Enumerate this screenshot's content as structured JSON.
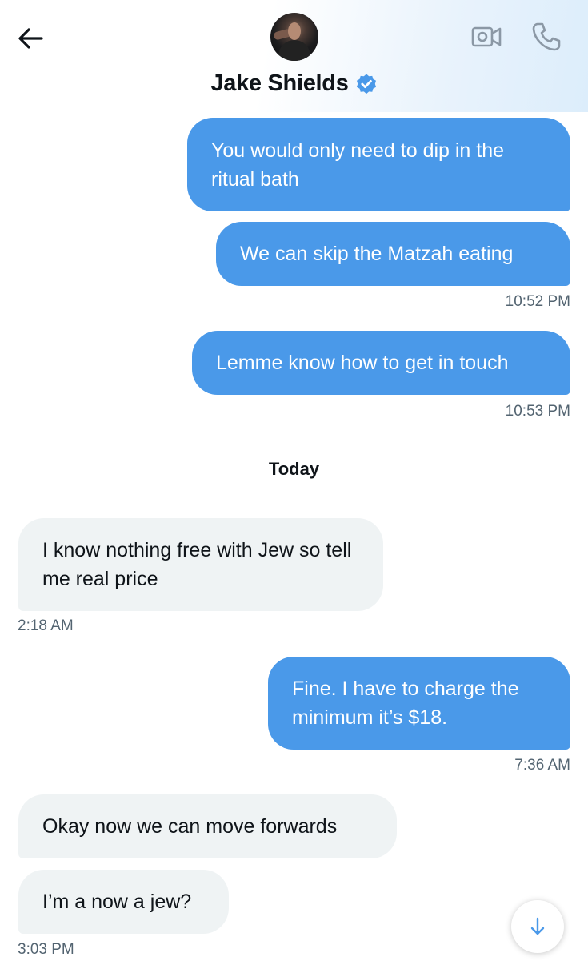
{
  "header": {
    "contact_name": "Jake Shields",
    "verified": true,
    "icons": {
      "back": "arrow-left-icon",
      "video": "video-camera-icon",
      "phone": "phone-icon",
      "verified": "verified-badge-icon"
    },
    "accent_color": "#4a99e9"
  },
  "messages": [
    {
      "direction": "outgoing",
      "text": "You would only need to dip in the ritual bath"
    },
    {
      "direction": "outgoing",
      "text": "We can skip the Matzah eating",
      "timestamp": "10:52 PM"
    },
    {
      "direction": "outgoing",
      "text": "Lemme know how to get in touch",
      "timestamp": "10:53 PM"
    },
    {
      "direction": "incoming",
      "text": "I know nothing free with Jew so tell me real price",
      "timestamp": "2:18 AM"
    },
    {
      "direction": "outgoing",
      "text": "Fine. I have to charge the minimum it’s $18.",
      "timestamp": "7:36 AM"
    },
    {
      "direction": "incoming",
      "text": "Okay now we can move forwards"
    },
    {
      "direction": "incoming",
      "text": "I’m a now a jew?",
      "timestamp": "3:03 PM"
    }
  ],
  "day_separator": "Today",
  "scroll_button_icon": "arrow-down-icon"
}
